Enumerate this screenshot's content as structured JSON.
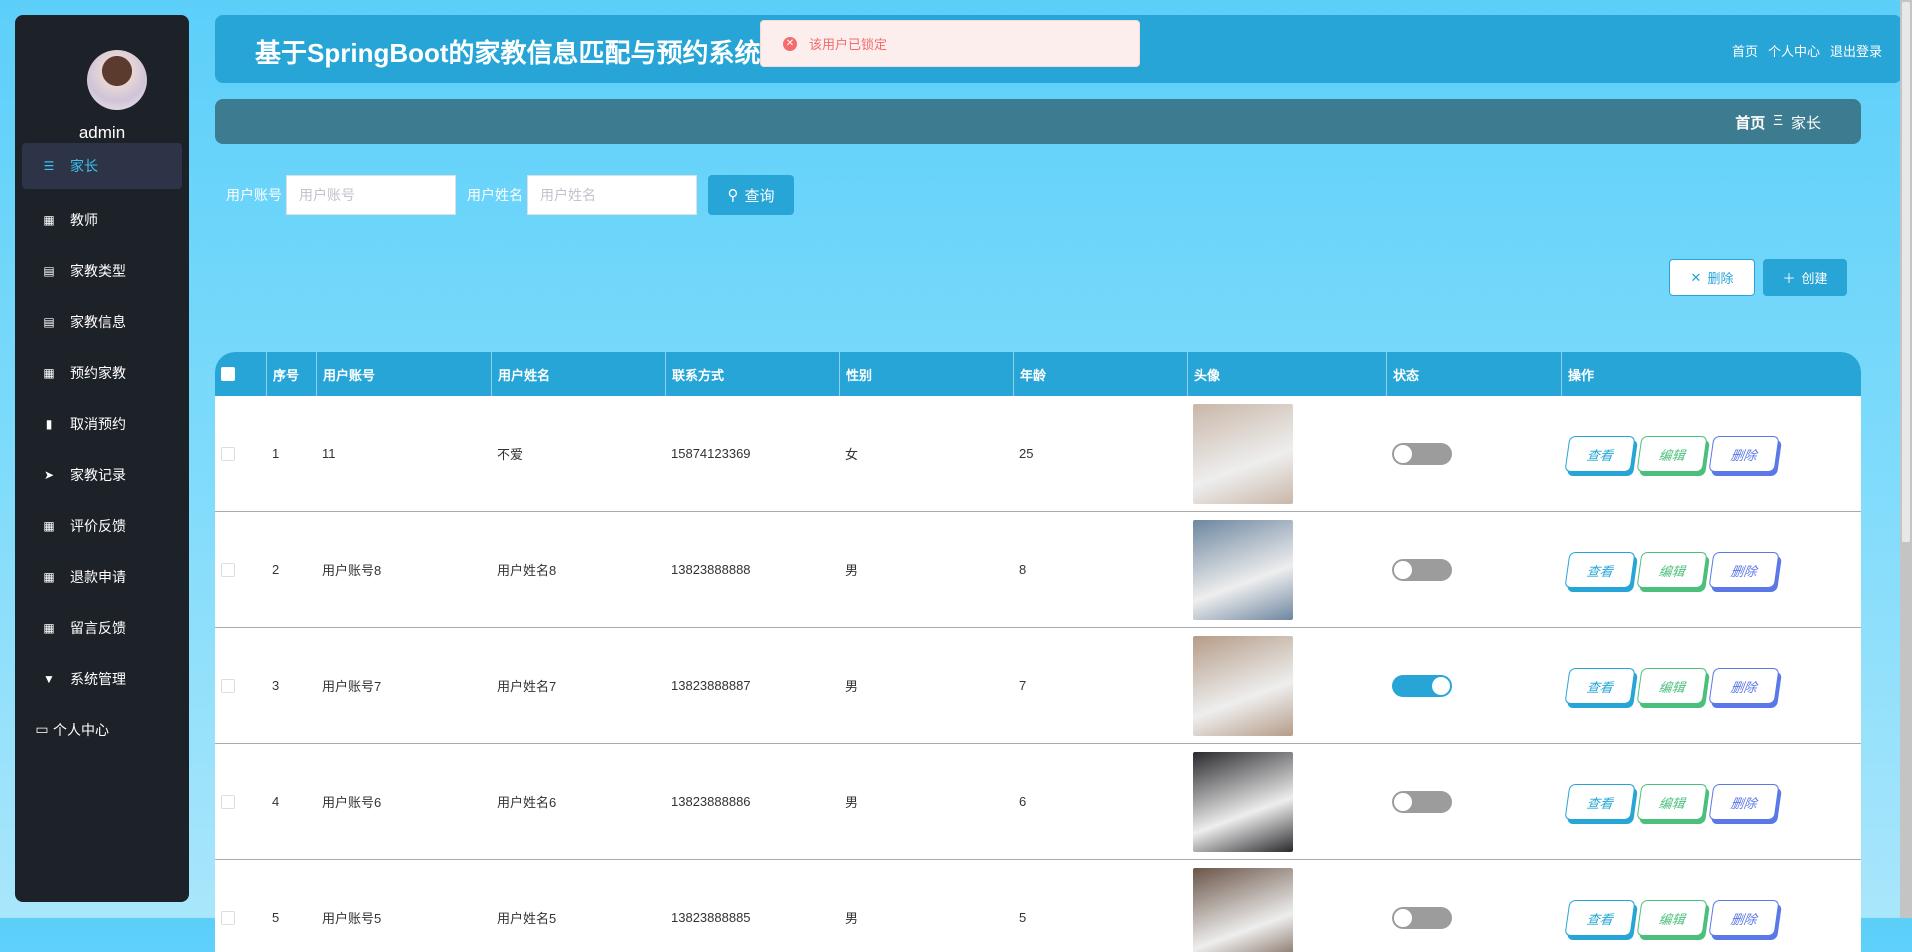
{
  "sidebar": {
    "username": "admin",
    "items": [
      {
        "label": "家长",
        "icon": "list-icon",
        "active": true
      },
      {
        "label": "教师",
        "icon": "grid-icon"
      },
      {
        "label": "家教类型",
        "icon": "clipboard-icon"
      },
      {
        "label": "家教信息",
        "icon": "clipboard-icon"
      },
      {
        "label": "预约家教",
        "icon": "grid-icon"
      },
      {
        "label": "取消预约",
        "icon": "bar-chart-icon"
      },
      {
        "label": "家教记录",
        "icon": "send-icon"
      },
      {
        "label": "评价反馈",
        "icon": "grid-icon"
      },
      {
        "label": "退款申请",
        "icon": "grid-icon"
      },
      {
        "label": "留言反馈",
        "icon": "grid-icon"
      },
      {
        "label": "系统管理",
        "icon": "brush-icon"
      },
      {
        "label": "个人中心",
        "icon": "wallet-icon"
      }
    ]
  },
  "header": {
    "title": "基于SpringBoot的家教信息匹配与预约系统",
    "links": [
      "首页",
      "个人中心",
      "退出登录"
    ]
  },
  "toast": {
    "message": "该用户已锁定",
    "type": "error"
  },
  "breadcrumb": {
    "home": "首页",
    "separator": "Ξ",
    "current": "家长"
  },
  "search": {
    "account_label": "用户账号",
    "account_placeholder": "用户账号",
    "account_value": "",
    "name_label": "用户姓名",
    "name_placeholder": "用户姓名",
    "name_value": "",
    "query_label": "查询"
  },
  "actions": {
    "delete_label": "删除",
    "create_label": "创建"
  },
  "table": {
    "columns": [
      "序号",
      "用户账号",
      "用户姓名",
      "联系方式",
      "性别",
      "年龄",
      "头像",
      "状态",
      "操作"
    ],
    "row_actions": [
      "查看",
      "编辑",
      "删除"
    ],
    "rows": [
      {
        "no": "1",
        "account": "11",
        "name": "不爱",
        "phone": "15874123369",
        "gender": "女",
        "age": "25",
        "status": false
      },
      {
        "no": "2",
        "account": "用户账号8",
        "name": "用户姓名8",
        "phone": "13823888888",
        "gender": "男",
        "age": "8",
        "status": false
      },
      {
        "no": "3",
        "account": "用户账号7",
        "name": "用户姓名7",
        "phone": "13823888887",
        "gender": "男",
        "age": "7",
        "status": true
      },
      {
        "no": "4",
        "account": "用户账号6",
        "name": "用户姓名6",
        "phone": "13823888886",
        "gender": "男",
        "age": "6",
        "status": false
      },
      {
        "no": "5",
        "account": "用户账号5",
        "name": "用户姓名5",
        "phone": "13823888885",
        "gender": "男",
        "age": "5",
        "status": false
      }
    ]
  },
  "colors": {
    "primary": "#26a5d6",
    "sidebar": "#1d2128",
    "crumb": "#3d7b90",
    "view": "#26a5d6",
    "edit": "#4cbf7c",
    "delete": "#5b78e8"
  }
}
